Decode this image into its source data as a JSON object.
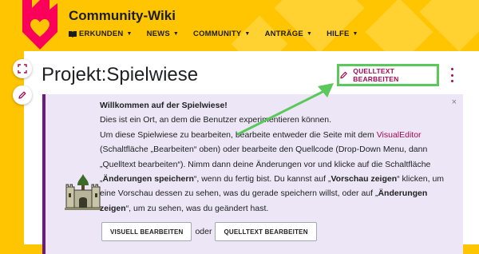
{
  "header": {
    "wiki_title": "Community-Wiki",
    "nav": [
      {
        "label": "ERKUNDEN",
        "icon": "book-icon"
      },
      {
        "label": "NEWS"
      },
      {
        "label": "COMMUNITY"
      },
      {
        "label": "ANTRÄGE"
      },
      {
        "label": "HILFE"
      }
    ]
  },
  "page": {
    "title": "Projekt:Spielwiese",
    "edit_source_label": "QUELLTEXT BEARBEITEN"
  },
  "notice": {
    "close": "×",
    "heading": "Willkommen auf der Spielwiese!",
    "line1": "Dies ist ein Ort, an dem die Benutzer experimentieren können.",
    "line2_a": "Um diese Spielwiese zu bearbeiten, bearbeite entweder die Seite mit dem ",
    "line2_link": "VisualEditor",
    "line3": "(Schaltfläche „Bearbeiten“ oben) oder bearbeite den Quellcode (Drop-Down Menu, dann",
    "line4": "„Quelltext bearbeiten“). Nimm dann deine Änderungen vor und klicke auf die Schaltfläche",
    "line5_b1": "Änderungen speichern",
    "line5_a": "“, wenn du fertig bist. Du kannst auf „",
    "line5_b2": "Vorschau zeigen",
    "line5_c": "“ klicken, um",
    "line6_a": "eine Vorschau dessen zu sehen, was du gerade speichern willst, oder auf „",
    "line6_b": "Änderungen",
    "line7_b": "zeigen",
    "line7_a": "“, um zu sehen, was du geändert hast.",
    "visual_button": "VISUELL BEARBEITEN",
    "or_text": "oder",
    "source_button": "QUELLTEXT BEARBEITEN"
  },
  "colors": {
    "header_bg": "#ffc500",
    "accent": "#a00d52",
    "highlight": "#5ac85a",
    "notice_border": "#6b1a86"
  }
}
